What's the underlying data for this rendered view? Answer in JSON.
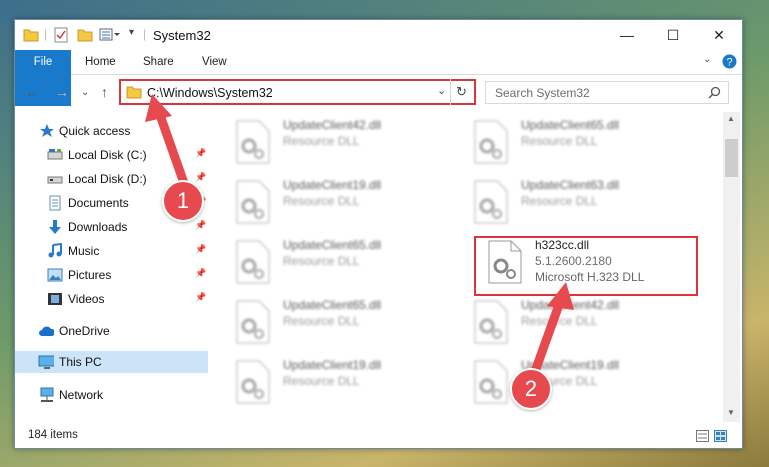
{
  "window": {
    "title": "System32"
  },
  "ribbon": {
    "tabs": [
      "File",
      "Home",
      "Share",
      "View"
    ]
  },
  "address": {
    "path": "C:\\Windows\\System32",
    "search_placeholder": "Search System32"
  },
  "sidebar": {
    "items": [
      {
        "label": "Quick access",
        "icon": "star-icon"
      },
      {
        "label": "Local Disk (C:)",
        "icon": "drive-icon"
      },
      {
        "label": "Local Disk (D:)",
        "icon": "drive-icon"
      },
      {
        "label": "Documents",
        "icon": "documents-icon"
      },
      {
        "label": "Downloads",
        "icon": "download-icon"
      },
      {
        "label": "Music",
        "icon": "music-icon"
      },
      {
        "label": "Pictures",
        "icon": "pictures-icon"
      },
      {
        "label": "Videos",
        "icon": "videos-icon"
      },
      {
        "label": "OneDrive",
        "icon": "cloud-icon"
      },
      {
        "label": "This PC",
        "icon": "computer-icon"
      },
      {
        "label": "Network",
        "icon": "network-icon"
      }
    ]
  },
  "files": [
    {
      "name": "UpdateClient42.dll",
      "desc": "Resource DLL"
    },
    {
      "name": "UpdateClient65.dll",
      "desc": "Resource DLL"
    },
    {
      "name": "UpdateClient19.dll",
      "desc": "Resource DLL"
    },
    {
      "name": "UpdateClient63.dll",
      "desc": "Resource DLL"
    },
    {
      "name": "UpdateClient65.dll",
      "desc": "Resource DLL"
    },
    {
      "name": "h323cc.dll",
      "version": "5.1.2600.2180",
      "desc": "Microsoft H.323 DLL"
    },
    {
      "name": "UpdateClient65.dll",
      "desc": "Resource DLL"
    },
    {
      "name": "UpdateClient42.dll",
      "desc": "Resource DLL"
    },
    {
      "name": "UpdateClient19.dll",
      "desc": "Resource DLL"
    },
    {
      "name": "UpdateClient19.dll",
      "desc": "Resource DLL"
    }
  ],
  "status": {
    "item_count": "184 items"
  },
  "annotations": {
    "step1": "1",
    "step2": "2"
  },
  "colors": {
    "accent": "#1979ca",
    "highlight": "#d8363a",
    "selected": "#cce4f7"
  }
}
